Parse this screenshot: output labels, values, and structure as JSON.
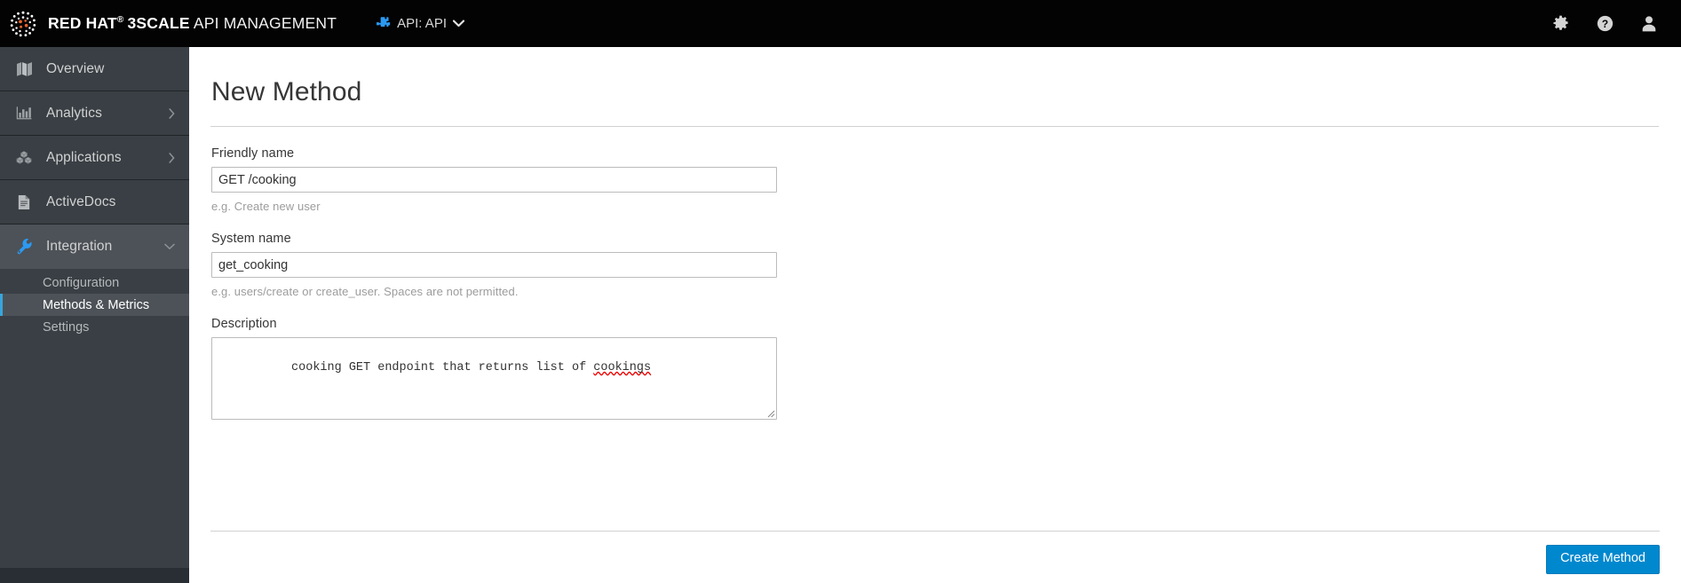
{
  "masthead": {
    "brand_bold": "RED HAT",
    "brand_tm": "®",
    "brand_bold2": "3SCALE",
    "brand_light": "API MANAGEMENT",
    "logo_icon": "red-hat-logo-icon",
    "api_selector": {
      "icon": "puzzle-piece-icon",
      "label": "API: API",
      "caret_icon": "chevron-down-icon"
    },
    "actions": [
      {
        "icon": "gear-icon",
        "name": "settings-icon"
      },
      {
        "icon": "question-circle-icon",
        "name": "help-icon"
      },
      {
        "icon": "user-icon",
        "name": "account-icon"
      }
    ]
  },
  "sidebar": {
    "items": [
      {
        "label": "Overview",
        "icon": "map-icon",
        "caret": "",
        "active": false
      },
      {
        "label": "Analytics",
        "icon": "bar-chart-icon",
        "caret": "›",
        "active": false
      },
      {
        "label": "Applications",
        "icon": "cubes-icon",
        "caret": "›",
        "active": false
      },
      {
        "label": "ActiveDocs",
        "icon": "file-text-icon",
        "caret": "",
        "active": false
      },
      {
        "label": "Integration",
        "icon": "wrench-icon",
        "caret": "⌄",
        "active": true
      }
    ],
    "subitems": [
      {
        "label": "Configuration",
        "active": false
      },
      {
        "label": "Methods & Metrics",
        "active": true
      },
      {
        "label": "Settings",
        "active": false
      }
    ]
  },
  "main": {
    "page_title": "New Method",
    "fields": [
      {
        "label": "Friendly name",
        "value": "GET /cooking",
        "placeholder": "",
        "hint": "e.g. Create new user"
      },
      {
        "label": "System name",
        "value": "get_cooking",
        "placeholder": "",
        "hint": "e.g. users/create or create_user. Spaces are not permitted."
      }
    ],
    "description": {
      "label": "Description",
      "value_before": "cooking GET endpoint that returns list of ",
      "value_misspelled": "cookings",
      "value_full": "cooking GET endpoint that returns list of cookings",
      "placeholder": ""
    },
    "submit_label": "Create Method"
  },
  "colors": {
    "masthead_bg": "#030303",
    "sidebar_bg": "#393f44",
    "sidebar_active_bg": "#4d5258",
    "accent_blue": "#39a5dc",
    "primary_button": "#0088ce",
    "icon_blue": "#2b9af3",
    "text_dark": "#363636",
    "hint_gray": "#9c9c9c",
    "border_gray": "#d1d1d1"
  }
}
